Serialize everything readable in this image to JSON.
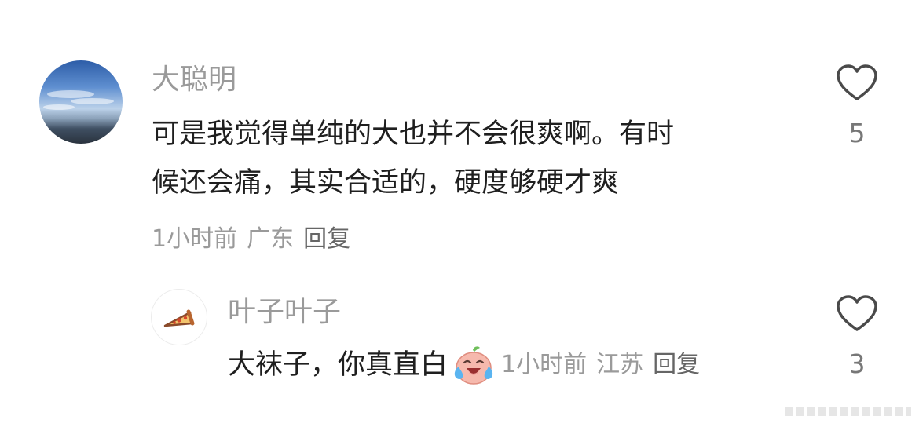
{
  "comment": {
    "username": "大聪明",
    "text_line1": "可是我觉得单纯的大也并不会很爽啊。有时",
    "text_line2": "候还会痛，其实合适的，硬度够硬才爽",
    "time": "1小时前",
    "location": "广东",
    "reply_label": "回复",
    "like_count": "5"
  },
  "reply": {
    "username": "叶子叶子",
    "text": "大袜子，你真直白",
    "time": "1小时前",
    "location": "江苏",
    "reply_label": "回复",
    "like_count": "3"
  },
  "icons": {
    "heart": "heart-outline-icon",
    "pizza": "pizza-icon",
    "emoji": "laughing-crying-emoji"
  },
  "colors": {
    "username": "#9a9a9a",
    "text": "#1f1f1f",
    "meta": "#9a9a9a",
    "heart_stroke": "#4a4a4a"
  }
}
